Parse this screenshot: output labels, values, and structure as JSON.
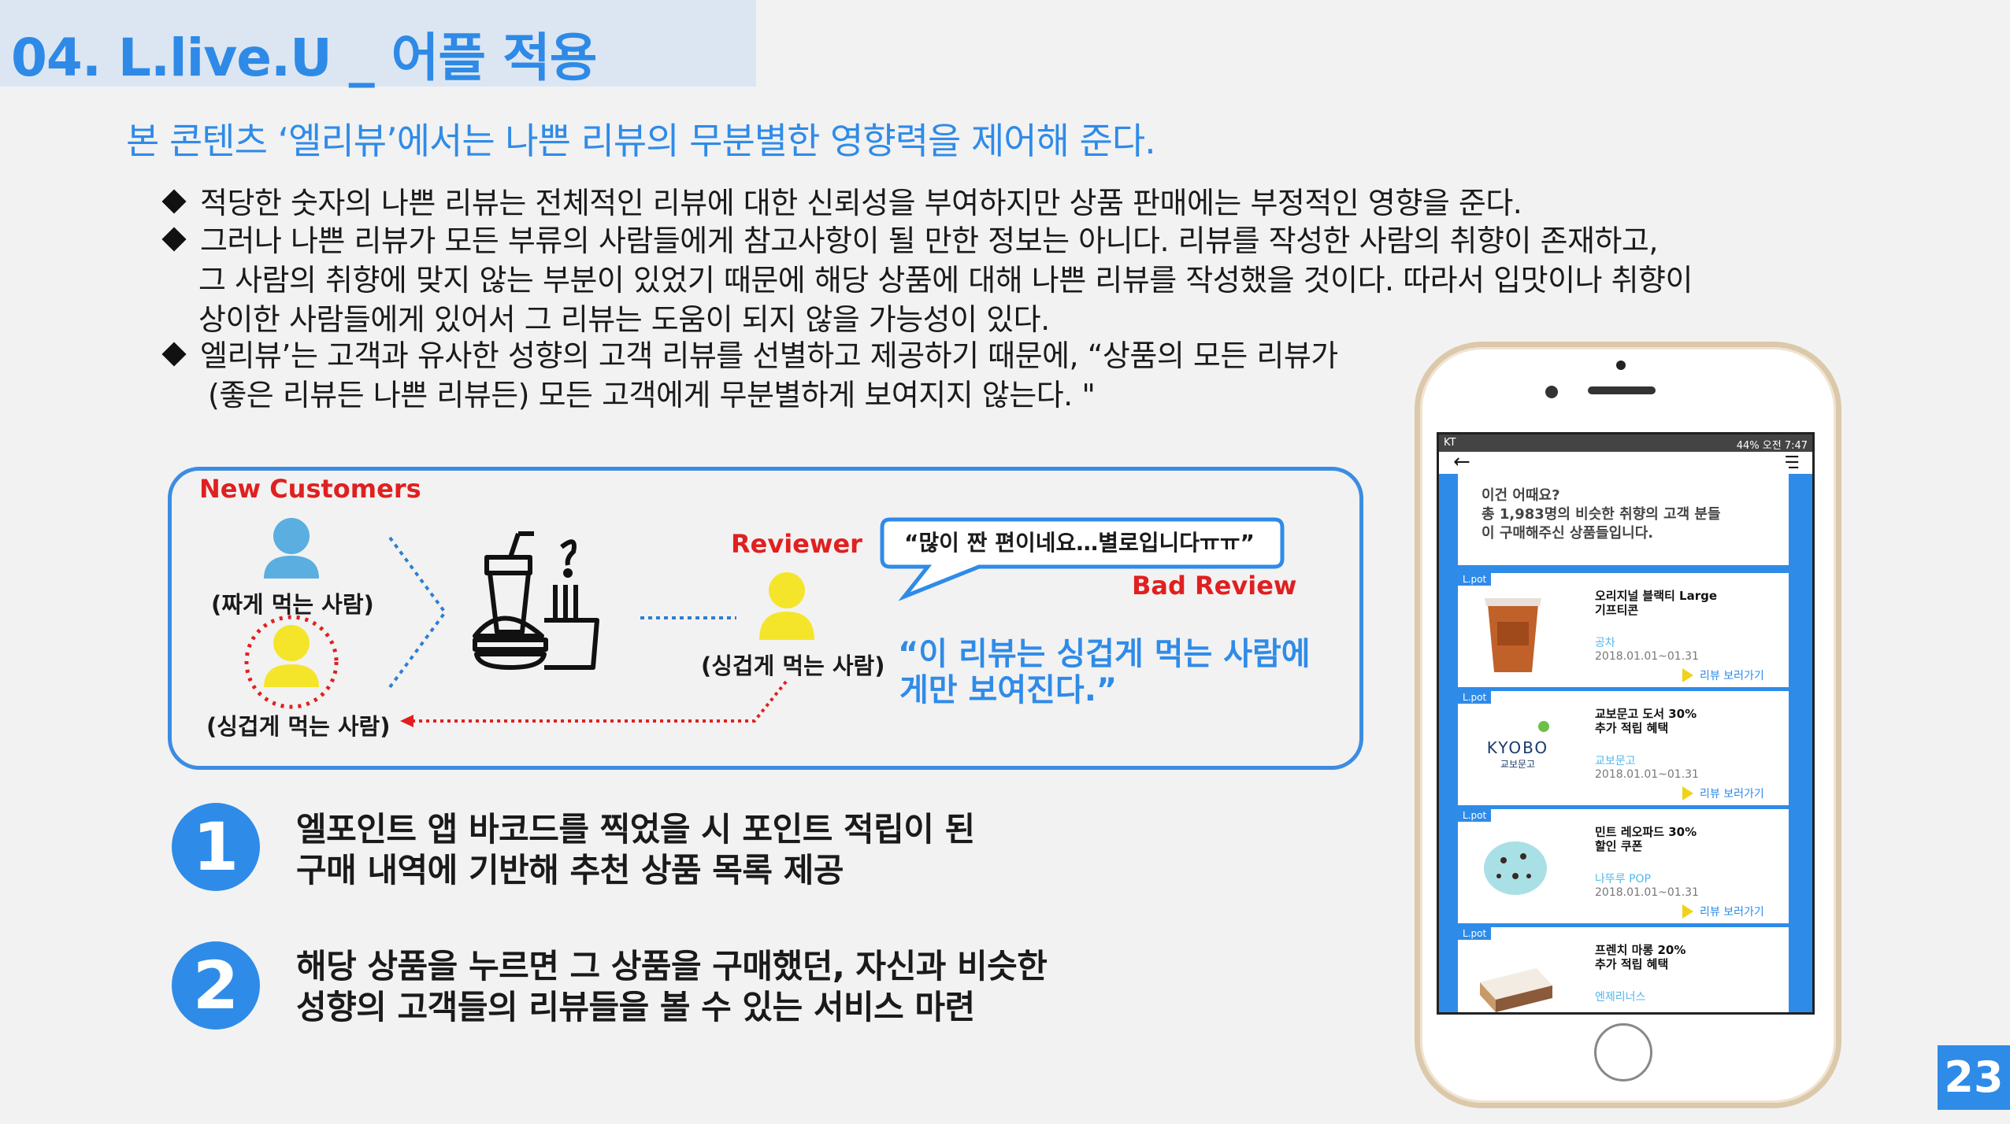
{
  "header": {
    "title": "04. L.live.U _ 어플 적용"
  },
  "subtitle": "본 콘텐츠 ‘엘리뷰’에서는 나쁜 리뷰의 무분별한 영향력을 제어해 준다.",
  "bullets": [
    {
      "lines": [
        "적당한 숫자의 나쁜 리뷰는 전체적인 리뷰에 대한 신뢰성을 부여하지만 상품 판매에는 부정적인 영향을 준다."
      ]
    },
    {
      "lines": [
        "그러나 나쁜 리뷰가 모든 부류의 사람들에게 참고사항이 될 만한 정보는 아니다. 리뷰를 작성한 사람의 취향이 존재하고,",
        "그 사람의 취향에 맞지 않는 부분이 있었기 때문에 해당 상품에 대해 나쁜 리뷰를 작성했을 것이다. 따라서 입맛이나 취향이",
        "상이한 사람들에게 있어서 그 리뷰는 도움이 되지 않을 가능성이 있다."
      ]
    },
    {
      "lines": [
        "엘리뷰’는 고객과 유사한 성향의 고객 리뷰를 선별하고 제공하기 때문에, “상품의 모든 리뷰가",
        "(좋은 리뷰든 나쁜 리뷰든) 모든 고객에게 무분별하게 보여지지 않는다. \""
      ]
    }
  ],
  "diagram": {
    "new_customers_label": "New Customers",
    "customer1_label": "(짜게 먹는 사람)",
    "customer2_label": "(싱겁게 먹는 사람)",
    "reviewer_title": "Reviewer",
    "reviewer_label": "(싱겁게 먹는 사람)",
    "bubble_text": "“많이 짠 편이네요…별로입니다ㅠㅠ”",
    "bad_review_label": "Bad Review",
    "quote_line1": "“이 리뷰는 싱겁게 먹는 사람에",
    "quote_line2": "게만 보여진다.”",
    "colors": {
      "blue": "#2f8be8",
      "red": "#e02020",
      "person_blue": "#5aaee0",
      "person_yellow": "#f5e52a"
    }
  },
  "features": [
    {
      "num": "1",
      "line1": "엘포인트 앱 바코드를 찍었을 시 포인트 적립이 된",
      "line2": "구매 내역에 기반해 추천 상품 목록 제공"
    },
    {
      "num": "2",
      "line1": "해당 상품을 누르면 그 상품을 구매했던, 자신과 비슷한",
      "line2": "성향의 고객들의 리뷰들을 볼 수 있는 서비스 마련"
    }
  ],
  "phone": {
    "status_left": "KT",
    "status_right": "44% 오전 7:47",
    "header_line1": "이건 어때요?",
    "header_line2": "총 1,983명의 비슷한 취향의 고객 분들",
    "header_line3": "이 구매해주신 상품들입니다.",
    "badge": "L.pot",
    "link_text": "리뷰 보러가기",
    "cards": [
      {
        "title1": "오리지널 블랙티 Large",
        "title2": "기프티콘",
        "brand": "공차",
        "date": "2018.01.01~01.31",
        "icon": "iced-tea-icon"
      },
      {
        "title1": "교보문고 도서 30%",
        "title2": "추가 적립 혜택",
        "brand": "교보문고",
        "date": "2018.01.01~01.31",
        "icon": "kyobo-logo",
        "logo_text1": "KYOBO",
        "logo_text2": "교보문고"
      },
      {
        "title1": "민트 레오파드 30%",
        "title2": "할인 쿠폰",
        "brand": "나뚜루 POP",
        "date": "2018.01.01~01.31",
        "icon": "mint-icecream-icon"
      },
      {
        "title1": "프렌치 마롱 20%",
        "title2": "추가 적립 혜택",
        "brand": "엔제리너스",
        "date": "",
        "icon": "cake-icon"
      }
    ]
  },
  "page_number": "23"
}
